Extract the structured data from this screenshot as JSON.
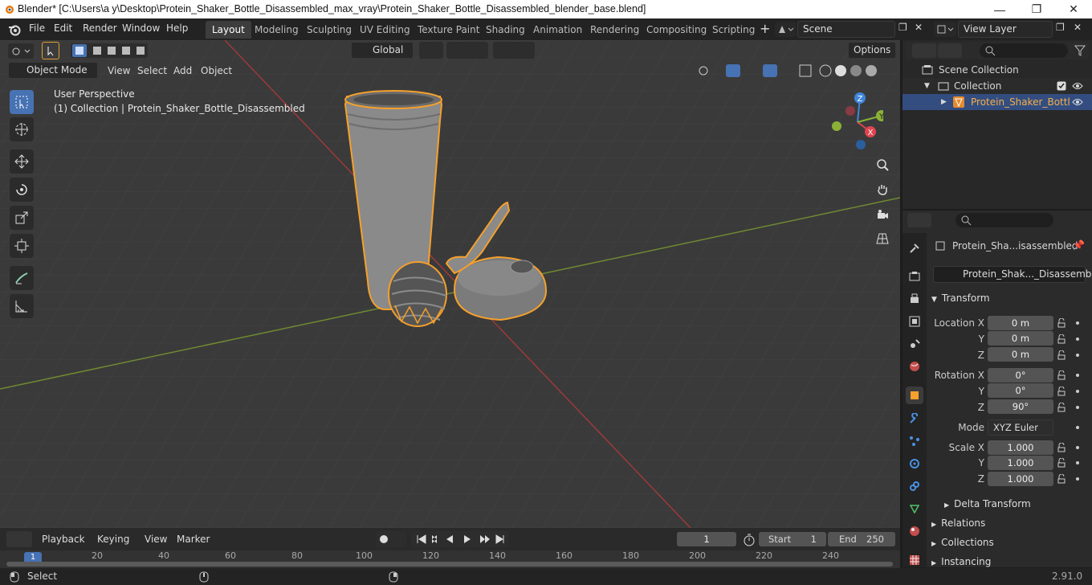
{
  "window": {
    "title": "Blender* [C:\\Users\\a y\\Desktop\\Protein_Shaker_Bottle_Disassembled_max_vray\\Protein_Shaker_Bottle_Disassembled_blender_base.blend]",
    "minimize": "—",
    "maximize": "❐",
    "close": "✕"
  },
  "menu": [
    "File",
    "Edit",
    "Render",
    "Window",
    "Help"
  ],
  "workspaces": [
    "Layout",
    "Modeling",
    "Sculpting",
    "UV Editing",
    "Texture Paint",
    "Shading",
    "Animation",
    "Rendering",
    "Compositing",
    "Scripting"
  ],
  "active_workspace": "Layout",
  "scene_name": "Scene",
  "view_layer": "View Layer",
  "viewport_header": {
    "transform_orientation": "Global",
    "options": "Options",
    "mode": "Object Mode",
    "view": "View",
    "select": "Select",
    "add": "Add",
    "object": "Object"
  },
  "viewport": {
    "perspective": "User Perspective",
    "collection_info": "(1) Collection | Protein_Shaker_Bottle_Disassembled",
    "gizmo": {
      "x": "X",
      "y": "Y",
      "z": "Z"
    }
  },
  "outliner": {
    "scene_collection": "Scene Collection",
    "collection": "Collection",
    "object": "Protein_Shaker_Bottl"
  },
  "properties": {
    "object_name": "Protein_Sha...isassembled",
    "data_name": "Protein_Shak..._Disassembled",
    "transform_title": "Transform",
    "location_label": "Location X",
    "rotation_label": "Rotation X",
    "scale_label": "Scale X",
    "y_label": "Y",
    "z_label": "Z",
    "location": [
      "0 m",
      "0 m",
      "0 m"
    ],
    "rotation": [
      "0°",
      "0°",
      "90°"
    ],
    "mode_label": "Mode",
    "mode_value": "XYZ Euler",
    "scale": [
      "1.000",
      "1.000",
      "1.000"
    ],
    "delta_transform": "Delta Transform",
    "relations": "Relations",
    "collections": "Collections",
    "instancing": "Instancing"
  },
  "timeline": {
    "playback": "Playback",
    "keying": "Keying",
    "view": "View",
    "marker": "Marker",
    "current_frame": "1",
    "start_label": "Start",
    "start_value": "1",
    "end_label": "End",
    "end_value": "250",
    "ticks": [
      "20",
      "40",
      "60",
      "80",
      "100",
      "120",
      "140",
      "160",
      "180",
      "200",
      "220",
      "240"
    ],
    "playhead": "1"
  },
  "status": {
    "left": "Select",
    "version": "2.91.0"
  },
  "colors": {
    "accent": "#4772b3",
    "selection": "#f5a02c",
    "x_axis": "#e0444f",
    "y_axis": "#8bb237",
    "z_axis": "#3f86db"
  }
}
